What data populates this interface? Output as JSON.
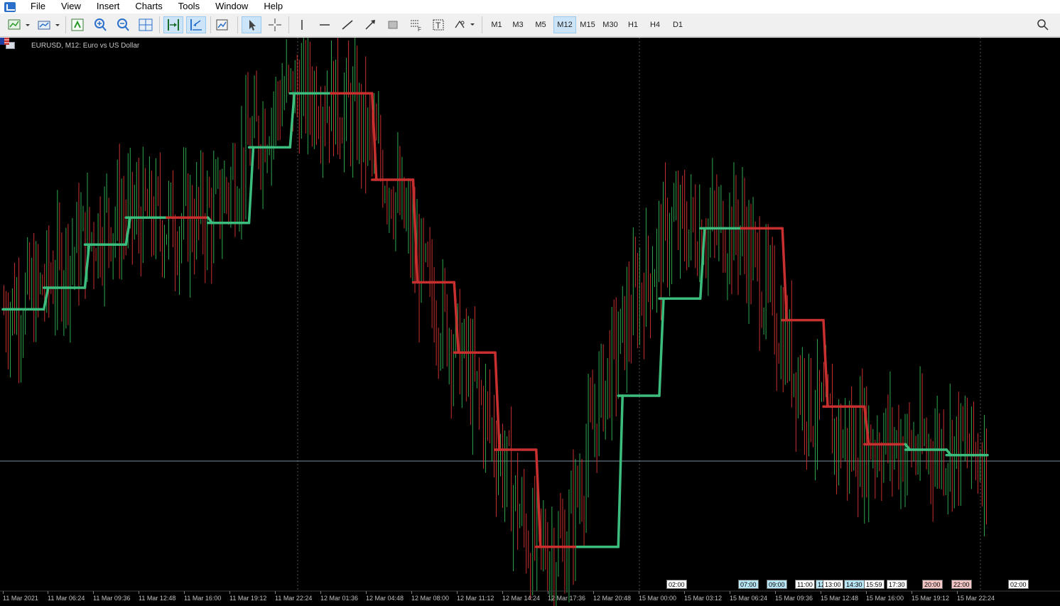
{
  "menu": {
    "items": [
      "File",
      "View",
      "Insert",
      "Charts",
      "Tools",
      "Window",
      "Help"
    ]
  },
  "toolbar": {
    "timeframes": [
      "M1",
      "M3",
      "M5",
      "M12",
      "M15",
      "M30",
      "H1",
      "H4",
      "D1"
    ],
    "active_timeframe": "M12"
  },
  "chart": {
    "title": "EURUSD, M12:  Euro vs US Dollar",
    "symbol": "EURUSD",
    "background": "#000000",
    "up_color": "#2fa84f",
    "down_color": "#c8302f",
    "trend_up_color": "#3dbd7d",
    "trend_down_color": "#c8302f",
    "x_labels": [
      "11 Mar 2021",
      "11 Mar 06:24",
      "11 Mar 09:36",
      "11 Mar 12:48",
      "11 Mar 16:00",
      "11 Mar 19:12",
      "11 Mar 22:24",
      "12 Mar 01:36",
      "12 Mar 04:48",
      "12 Mar 08:00",
      "12 Mar 11:12",
      "12 Mar 14:24",
      "12 Mar 17:36",
      "12 Mar 20:48",
      "15 Mar 00:00",
      "15 Mar 03:12",
      "15 Mar 06:24",
      "15 Mar 09:36",
      "15 Mar 12:48",
      "15 Mar 16:00",
      "15 Mar 19:12",
      "15 Mar 22:24"
    ],
    "session_marks": [
      {
        "label": "02:00",
        "color": "#ffffff"
      },
      {
        "label": "07:00",
        "color": "#b9e6f5"
      },
      {
        "label": "09:00",
        "color": "#b9e6f5"
      },
      {
        "label": "11:00",
        "color": "#ffffff"
      },
      {
        "label": "12",
        "color": "#b9e6f5"
      },
      {
        "label": "13:00",
        "color": "#ffffff"
      },
      {
        "label": "14:30",
        "color": "#b9e6f5"
      },
      {
        "label": "15:59",
        "color": "#ffffff"
      },
      {
        "label": "17:30",
        "color": "#ffffff"
      },
      {
        "label": "20:00",
        "color": "#f5c6c6"
      },
      {
        "label": "22:00",
        "color": "#f5c6c6"
      },
      {
        "label": "02:00",
        "color": "#ffffff"
      }
    ],
    "price_levels": [
      1.1926,
      1.1929,
      1.1937,
      1.1943,
      1.1943,
      1.1942,
      1.1944,
      1.1956,
      1.1966,
      1.1966,
      1.1962,
      1.195,
      1.1931,
      1.1918,
      1.1902,
      1.1882,
      1.1882,
      1.191,
      1.1928,
      1.1941,
      1.1941,
      1.1941,
      1.1924,
      1.1908,
      1.1901,
      1.1902,
      1.19,
      1.1901,
      1.1899
    ],
    "trend_line": [
      {
        "v": 1.1926,
        "dir": "up"
      },
      {
        "v": 1.193,
        "dir": "up"
      },
      {
        "v": 1.1938,
        "dir": "up"
      },
      {
        "v": 1.1943,
        "dir": "up"
      },
      {
        "v": 1.1943,
        "dir": "down"
      },
      {
        "v": 1.1942,
        "dir": "up"
      },
      {
        "v": 1.1956,
        "dir": "up"
      },
      {
        "v": 1.1966,
        "dir": "up"
      },
      {
        "v": 1.1966,
        "dir": "down"
      },
      {
        "v": 1.195,
        "dir": "down"
      },
      {
        "v": 1.1931,
        "dir": "down"
      },
      {
        "v": 1.1918,
        "dir": "down"
      },
      {
        "v": 1.19,
        "dir": "down"
      },
      {
        "v": 1.1882,
        "dir": "down"
      },
      {
        "v": 1.1882,
        "dir": "up"
      },
      {
        "v": 1.191,
        "dir": "up"
      },
      {
        "v": 1.1928,
        "dir": "up"
      },
      {
        "v": 1.1941,
        "dir": "up"
      },
      {
        "v": 1.1941,
        "dir": "down"
      },
      {
        "v": 1.1924,
        "dir": "down"
      },
      {
        "v": 1.1908,
        "dir": "down"
      },
      {
        "v": 1.1901,
        "dir": "down"
      },
      {
        "v": 1.19,
        "dir": "up"
      },
      {
        "v": 1.1899,
        "dir": "up"
      }
    ]
  }
}
